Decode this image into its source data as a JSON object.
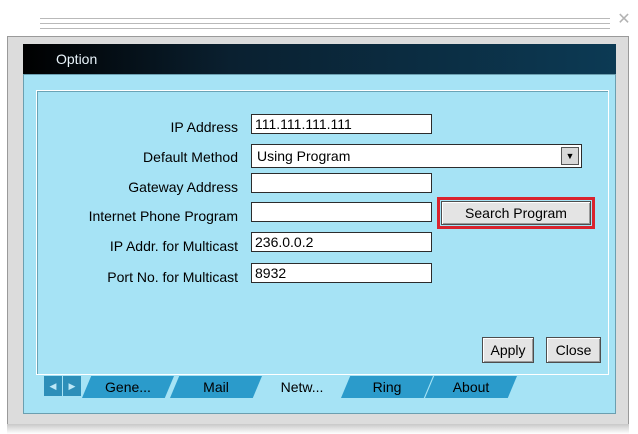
{
  "window": {
    "title": "Option",
    "close_icon": "close-icon"
  },
  "form": {
    "ip_address_label": "IP Address",
    "ip_address_value": "111.111.111.111",
    "default_method_label": "Default Method",
    "default_method_value": "Using Program",
    "gateway_label": "Gateway Address",
    "gateway_value": "",
    "phone_program_label": "Internet Phone Program",
    "phone_program_value": "",
    "multicast_ip_label": "IP Addr. for Multicast",
    "multicast_ip_value": "236.0.0.2",
    "multicast_port_label": "Port No. for Multicast",
    "multicast_port_value": "8932"
  },
  "buttons": {
    "search_program": "Search Program",
    "apply": "Apply",
    "close": "Close"
  },
  "tabs": [
    {
      "label": "Gene...",
      "active": false
    },
    {
      "label": "Mail",
      "active": false
    },
    {
      "label": "Netw...",
      "active": true
    },
    {
      "label": "Ring",
      "active": false
    },
    {
      "label": "About",
      "active": false
    }
  ],
  "colors": {
    "panel_bg": "#a6e3f5",
    "titlebar_dark": "#000000",
    "highlight_border": "#d9232d",
    "tab_inactive": "#2b9bcb"
  }
}
